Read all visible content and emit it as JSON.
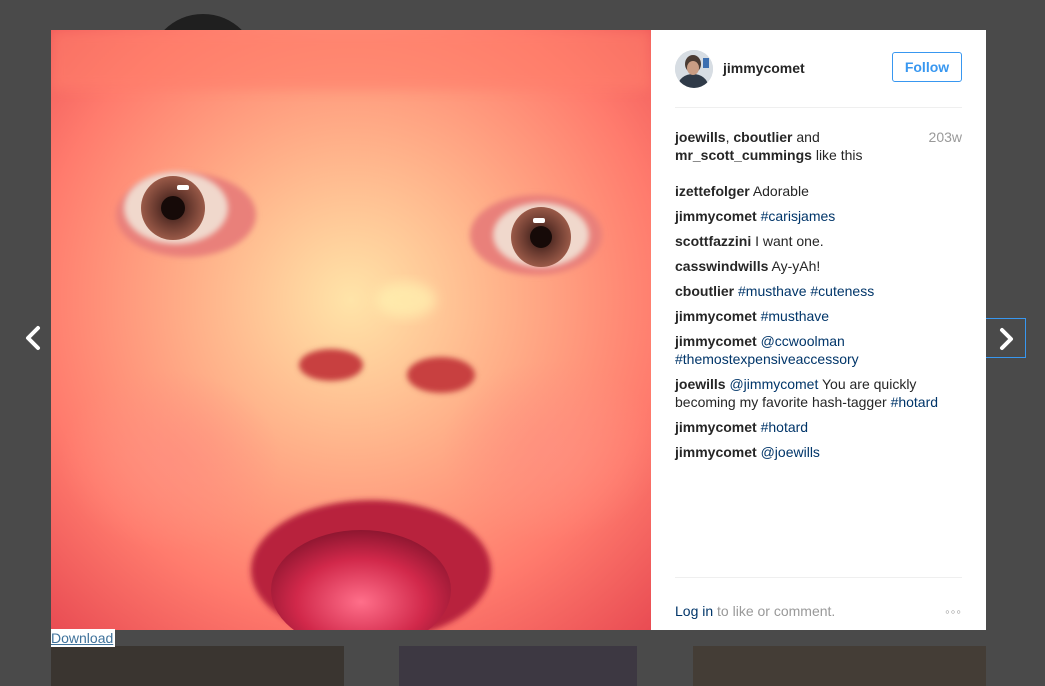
{
  "post": {
    "username": "jimmycomet",
    "follow_label": "Follow",
    "liked_by": [
      "joewills",
      "cboutlier"
    ],
    "liked_by_sep": ",",
    "and_text": "and",
    "liked_by_last": "mr_scott_cummings",
    "like_this_text": "like this",
    "time_ago": "203w"
  },
  "comments": [
    {
      "user": "izettefolger",
      "text": "Adorable",
      "tags": []
    },
    {
      "user": "jimmycomet",
      "text": "",
      "tags": [
        "#carisjames"
      ]
    },
    {
      "user": "scottfazzini",
      "text": "I want one.",
      "tags": []
    },
    {
      "user": "casswindwills",
      "text": "Ay-yAh!",
      "tags": []
    },
    {
      "user": "cboutlier",
      "text": "",
      "tags": [
        "#musthave",
        "#cuteness"
      ]
    },
    {
      "user": "jimmycomet",
      "text": "",
      "tags": [
        "#musthave"
      ]
    },
    {
      "user": "jimmycomet",
      "text": "",
      "tags": [
        "@ccwoolman",
        "#themostexpensiveaccessory"
      ]
    },
    {
      "user": "joewills",
      "mention": "@jimmycomet",
      "text": "You are quickly becoming my favorite hash-tagger",
      "tags": [
        "#hotard"
      ]
    },
    {
      "user": "jimmycomet",
      "text": "",
      "tags": [
        "#hotard"
      ]
    },
    {
      "user": "jimmycomet",
      "text": "",
      "tags": [
        "@joewills"
      ]
    }
  ],
  "footer": {
    "login_link": "Log in",
    "login_rest": "to like or comment.",
    "more_icon": "ellipsis-icon",
    "more_text": "◦◦◦"
  },
  "download_label": "Download",
  "icons": {
    "prev": "chevron-left-icon",
    "next": "chevron-right-icon"
  },
  "colors": {
    "link": "#003569",
    "follow": "#3897f0",
    "muted": "#999999"
  }
}
